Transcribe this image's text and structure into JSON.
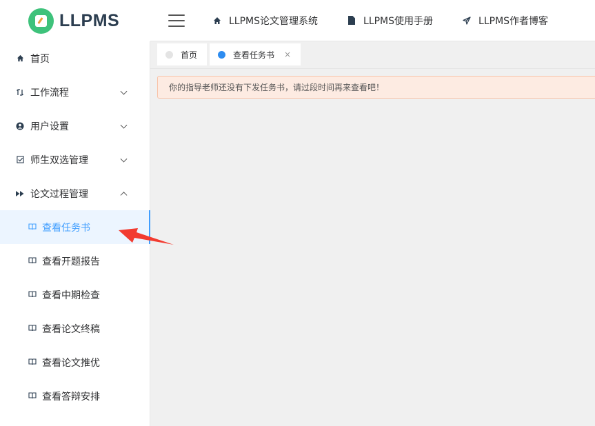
{
  "logo": {
    "text": "LLPMS"
  },
  "header": {
    "links": [
      {
        "label": "LLPMS论文管理系统",
        "icon": "home-icon"
      },
      {
        "label": "LLPMS使用手册",
        "icon": "document-icon"
      },
      {
        "label": "LLPMS作者博客",
        "icon": "send-icon"
      }
    ]
  },
  "sidebar": {
    "items": [
      {
        "label": "首页",
        "icon": "home-icon"
      },
      {
        "label": "工作流程",
        "icon": "workflow-icon"
      },
      {
        "label": "用户设置",
        "icon": "user-circle-icon"
      },
      {
        "label": "师生双选管理",
        "icon": "checkbox-icon"
      },
      {
        "label": "论文过程管理",
        "icon": "fast-forward-icon"
      }
    ],
    "sub_items": [
      {
        "label": "查看任务书",
        "active": true
      },
      {
        "label": "查看开题报告"
      },
      {
        "label": "查看中期检查"
      },
      {
        "label": "查看论文终稿"
      },
      {
        "label": "查看论文推优"
      },
      {
        "label": "查看答辩安排"
      }
    ]
  },
  "tabs": [
    {
      "label": "首页"
    },
    {
      "label": "查看任务书",
      "active": true,
      "close": "×"
    }
  ],
  "alert": {
    "text": "你的指导老师还没有下发任务书，请过段时间再来查看吧！"
  },
  "colors": {
    "accent": "#409eff",
    "logo_green": "#3ec27b",
    "alert_bg": "#fdebe2",
    "annotation_red": "#f23b30"
  }
}
